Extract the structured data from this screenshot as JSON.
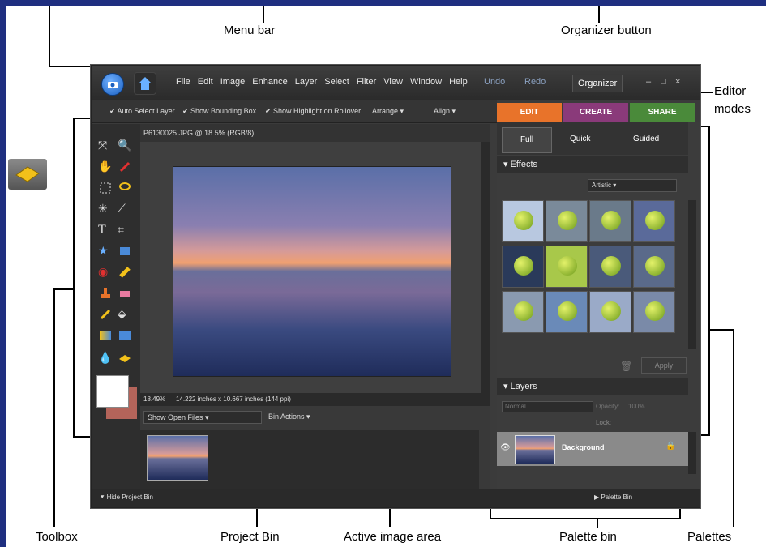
{
  "callouts": {
    "menu_bar": "Menu bar",
    "organizer_button": "Organizer button",
    "editor_modes_1": "Editor",
    "editor_modes_2": "modes",
    "toolbox": "Toolbox",
    "project_bin": "Project Bin",
    "active_image_area": "Active image area",
    "palette_bin": "Palette bin",
    "palettes": "Palettes"
  },
  "menu": [
    "File",
    "Edit",
    "Image",
    "Enhance",
    "Layer",
    "Select",
    "Filter",
    "View",
    "Window",
    "Help"
  ],
  "titlebar": {
    "undo": "Undo",
    "redo": "Redo",
    "organizer": "Organizer",
    "minimize": "–",
    "restore": "□",
    "close": "×"
  },
  "options": {
    "auto_select_layer": "Auto Select Layer",
    "show_bounding_box": "Show Bounding Box",
    "show_highlight": "Show Highlight on Rollover",
    "arrange": "Arrange",
    "align": "Align"
  },
  "modes": {
    "edit": "EDIT",
    "create": "CREATE",
    "share": "SHARE"
  },
  "document": {
    "title": "P6130025.JPG @ 18.5% (RGB/8)",
    "zoom": "18.49%",
    "dimensions": "14.222 inches x 10.667 inches (144 ppi)"
  },
  "bin": {
    "show": "Show Open Files",
    "actions": "Bin Actions"
  },
  "bottom": {
    "hide_project_bin": "Hide Project Bin",
    "palette_bin": "Palette Bin"
  },
  "edit_tabs": {
    "full": "Full",
    "quick": "Quick",
    "guided": "Guided"
  },
  "effects": {
    "title": "Effects",
    "category": "Artistic",
    "apply": "Apply"
  },
  "layers": {
    "title": "Layers",
    "blend": "Normal",
    "opacity_label": "Opacity:",
    "opacity": "100%",
    "lock": "Lock:",
    "background": "Background"
  }
}
